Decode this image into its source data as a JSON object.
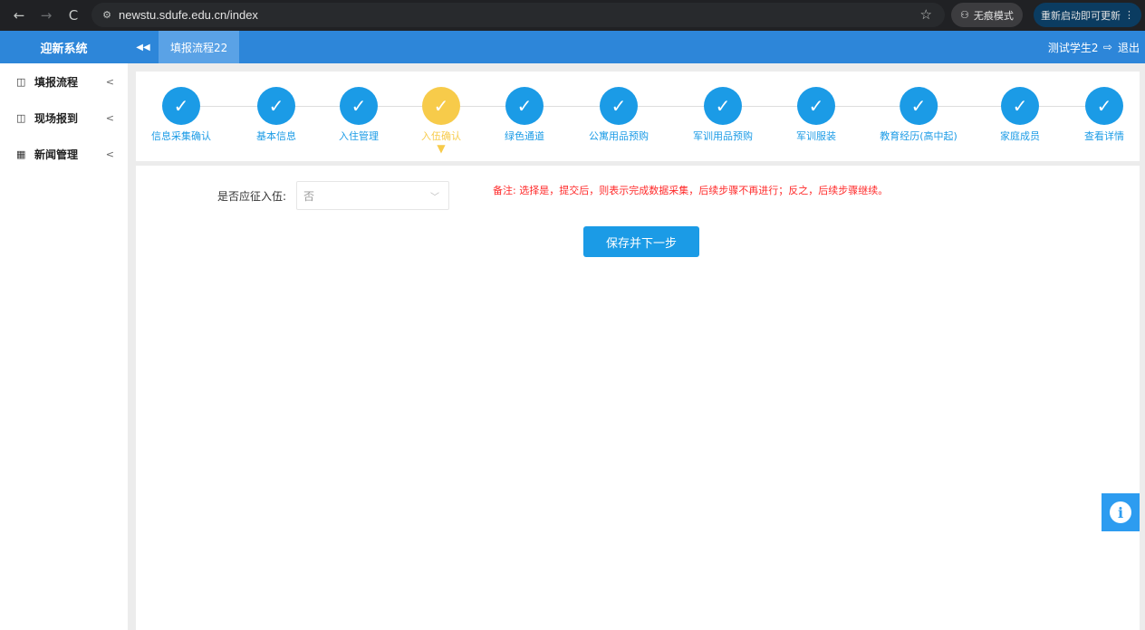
{
  "browser": {
    "back_icon": "←",
    "forward_icon": "→",
    "reload_icon": "C",
    "site_icon": "⚙",
    "url": "newstu.sdufe.edu.cn/index",
    "star_icon": "☆",
    "incognito_label": "无痕模式",
    "incognito_icon": "⚇",
    "update_label": "重新启动即可更新",
    "menu_icon": "⋮"
  },
  "header": {
    "logo": "迎新系统",
    "collapse_icon": "◀◀",
    "active_tab": "填报流程22",
    "user_name": "测试学生2",
    "logout_icon": "⇨",
    "logout_label": "退出"
  },
  "sidebar": {
    "items": [
      {
        "label": "填报流程",
        "icon": "◫",
        "arrow": "<"
      },
      {
        "label": "现场报到",
        "icon": "◫",
        "arrow": "<"
      },
      {
        "label": "新闻管理",
        "icon": "▦",
        "arrow": "<"
      }
    ]
  },
  "steps": {
    "check_icon": "✓",
    "pointer_icon": "▼",
    "items": [
      {
        "label": "信息采集确认"
      },
      {
        "label": "基本信息"
      },
      {
        "label": "入住管理"
      },
      {
        "label": "入伍确认"
      },
      {
        "label": "绿色通道"
      },
      {
        "label": "公寓用品预购"
      },
      {
        "label": "军训用品预购"
      },
      {
        "label": "军训服装"
      },
      {
        "label": "教育经历(高中起)"
      },
      {
        "label": "家庭成员"
      },
      {
        "label": "查看详情"
      }
    ],
    "active_index": 3
  },
  "form": {
    "field_label": "是否应征入伍:",
    "select_value": "否",
    "chevron_icon": "﹀",
    "remark": "备注:  选择是，提交后，则表示完成数据采集，后续步骤不再进行；反之，后续步骤继续。",
    "save_button": "保存并下一步"
  },
  "info_button": {
    "icon": "i"
  }
}
